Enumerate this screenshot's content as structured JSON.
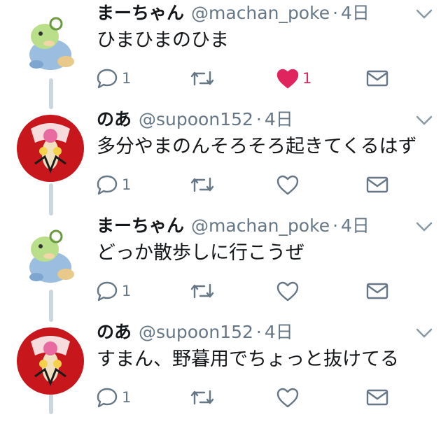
{
  "colors": {
    "text": "#14171a",
    "secondary": "#657786",
    "like": "#e0245e",
    "thread_line": "#ccd6dd"
  },
  "tweets": [
    {
      "name": "まーちゃん",
      "handle": "@machan_poke",
      "separator": "·",
      "time": "4日",
      "text": "ひまひまのひま",
      "reply_count": "1",
      "retweet_count": "",
      "like_count": "1",
      "liked": true,
      "avatar": "green-pokemon-avatar"
    },
    {
      "name": "のあ",
      "handle": "@supoon152",
      "separator": "·",
      "time": "4日",
      "text": "多分やまのんそろそろ起きてくるはず",
      "reply_count": "1",
      "retweet_count": "",
      "like_count": "",
      "liked": false,
      "avatar": "red-pokemon-avatar"
    },
    {
      "name": "まーちゃん",
      "handle": "@machan_poke",
      "separator": "·",
      "time": "4日",
      "text": "どっか散歩しに行こうぜ",
      "reply_count": "1",
      "retweet_count": "",
      "like_count": "",
      "liked": false,
      "avatar": "green-pokemon-avatar"
    },
    {
      "name": "のあ",
      "handle": "@supoon152",
      "separator": "·",
      "time": "4日",
      "text": "すまん、野暮用でちょっと抜けてる",
      "reply_count": "1",
      "retweet_count": "",
      "like_count": "",
      "liked": false,
      "avatar": "red-pokemon-avatar"
    }
  ]
}
